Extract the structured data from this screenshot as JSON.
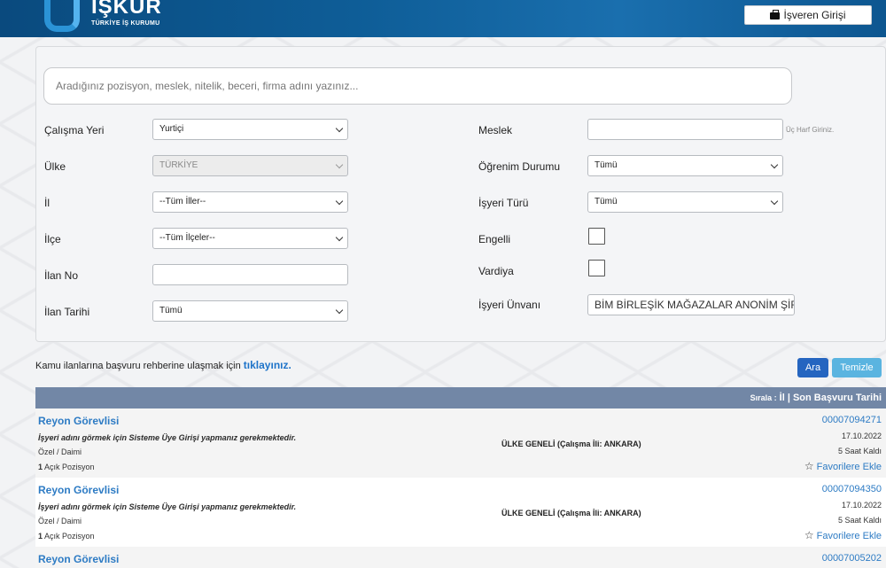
{
  "header": {
    "logo_text": "IŞKUR",
    "logo_subtitle": "TÜRKİYE İŞ KURUMU",
    "employer_login_label": "İşveren Girişi",
    "employer_icon": "briefcase-icon",
    "bg_color": "#0e5d97"
  },
  "search": {
    "placeholder": "Aradığınız pozisyon, meslek, nitelik, beceri, firma adını yazınız..."
  },
  "filters": {
    "calisma_yeri": {
      "label": "Çalışma Yeri",
      "value": "Yurtiçi"
    },
    "ulke": {
      "label": "Ülke",
      "value": "TÜRKİYE"
    },
    "il": {
      "label": "İl",
      "value": "--Tüm İller--"
    },
    "ilce": {
      "label": "İlçe",
      "value": "--Tüm İlçeler--"
    },
    "ilan_no": {
      "label": "İlan No",
      "value": ""
    },
    "ilan_tarihi": {
      "label": "İlan Tarihi",
      "value": "Tümü"
    },
    "meslek": {
      "label": "Meslek",
      "value": "",
      "hint": "Üç Harf Giriniz."
    },
    "ogrenim": {
      "label": "Öğrenim Durumu",
      "value": "Tümü"
    },
    "isyeri_turu": {
      "label": "İşyeri Türü",
      "value": "Tümü"
    },
    "engelli": {
      "label": "Engelli",
      "checked": false
    },
    "vardiya": {
      "label": "Vardiya",
      "checked": false
    },
    "isyeri_unvani": {
      "label": "İşyeri Ünvanı",
      "value": "BİM BİRLEŞİK MAĞAZALAR ANONİM ŞİRI"
    }
  },
  "notice": {
    "text": "Kamu ilanlarına başvuru rehberine ulaşmak için",
    "link": "tıklayınız."
  },
  "buttons": {
    "search": "Ara",
    "clear": "Temizle"
  },
  "results": {
    "sort_prefix": "Sırala :",
    "sort_options": "İl | Son Başvuru Tarihi",
    "rows": [
      {
        "title": "Reyon Görevlisi",
        "message": "İşyeri adını görmek için Sisteme Üye Girişi yapmanız gerekmektedir.",
        "type": "Özel / Daimi",
        "open_count": "1",
        "open_label": "Açık Pozisyon",
        "location": "ÜLKE GENELİ (Çalışma İli: ANKARA)",
        "listing_no": "00007094271",
        "date": "17.10.2022",
        "remaining": "5 Saat Kaldı",
        "favorite": "Favorilere Ekle"
      },
      {
        "title": "Reyon Görevlisi",
        "message": "İşyeri adını görmek için Sisteme Üye Girişi yapmanız gerekmektedir.",
        "type": "Özel / Daimi",
        "open_count": "1",
        "open_label": "Açık Pozisyon",
        "location": "ÜLKE GENELİ (Çalışma İli: ANKARA)",
        "listing_no": "00007094350",
        "date": "17.10.2022",
        "remaining": "5 Saat Kaldı",
        "favorite": "Favorilere Ekle"
      },
      {
        "title": "Reyon Görevlisi",
        "listing_no": "00007005202"
      }
    ]
  }
}
